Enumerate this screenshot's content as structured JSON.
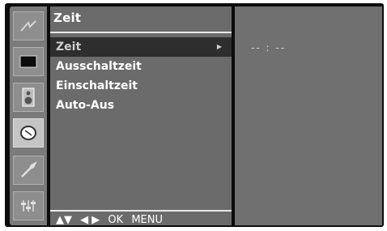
{
  "menu": {
    "title": "Zeit",
    "items": [
      {
        "label": "Zeit",
        "selected": true
      },
      {
        "label": "Ausschaltzeit",
        "selected": false
      },
      {
        "label": "Einschaltzeit",
        "selected": false
      },
      {
        "label": "Auto-Aus",
        "selected": false
      }
    ],
    "submenu_arrow": "▶"
  },
  "sidebar": {
    "icons": [
      {
        "name": "antenna-icon"
      },
      {
        "name": "picture-icon"
      },
      {
        "name": "speaker-icon"
      },
      {
        "name": "clock-icon",
        "active": true
      },
      {
        "name": "wrench-icon"
      },
      {
        "name": "options-icon"
      }
    ]
  },
  "footer": {
    "updown": "▲▼",
    "leftright": "◀ ▶",
    "ok": "OK",
    "menu": "MENU"
  },
  "value_panel": {
    "time_display": "-- : --"
  }
}
